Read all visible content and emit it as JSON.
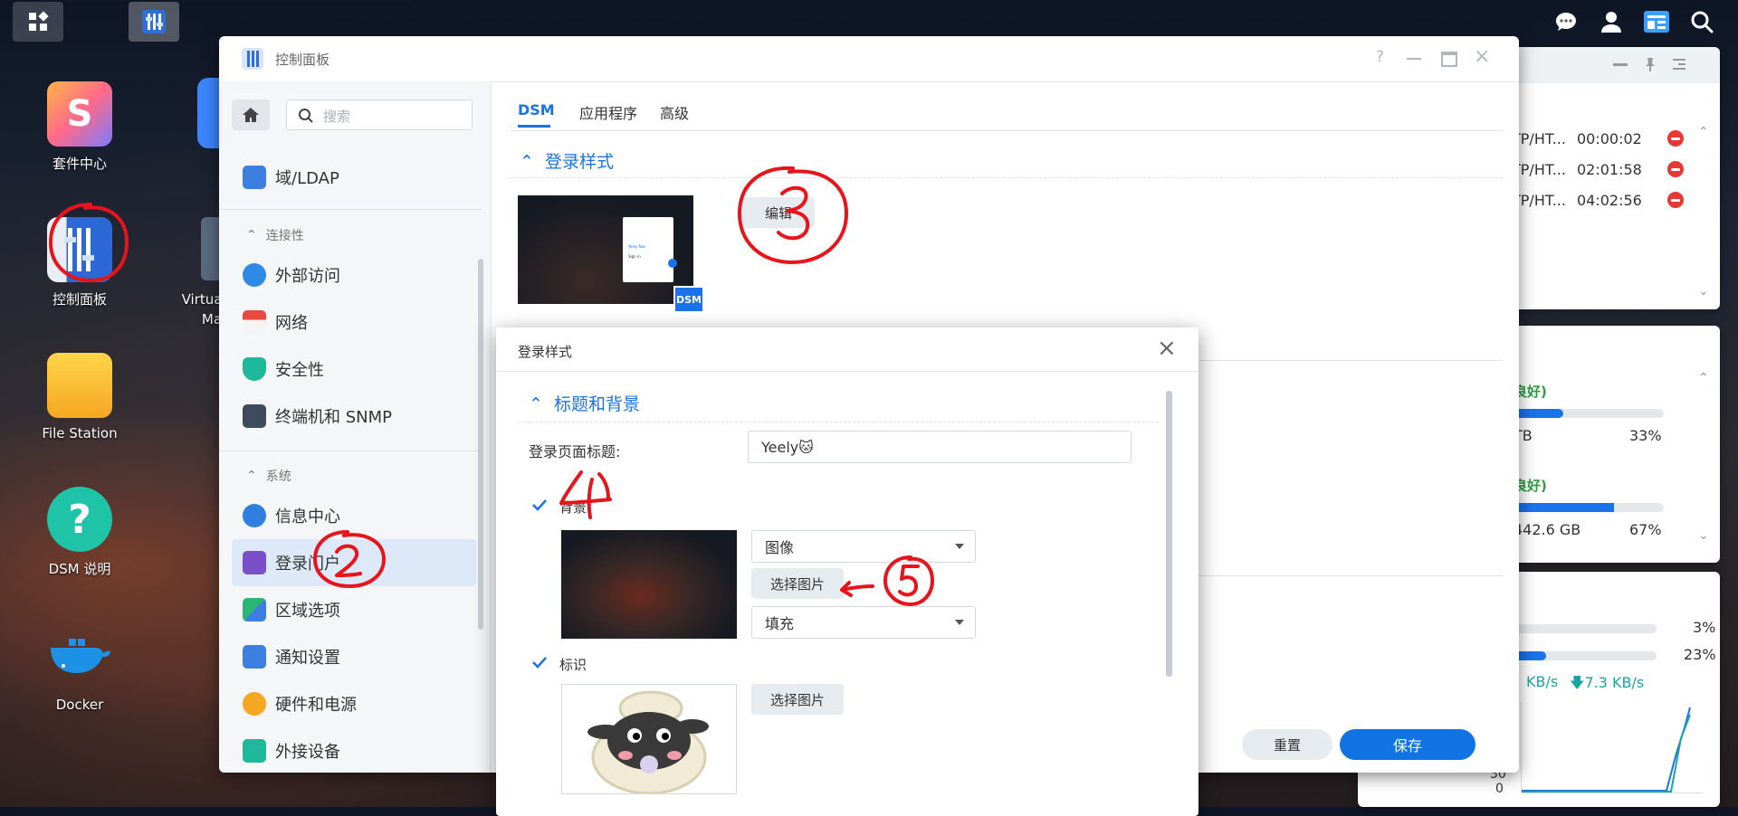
{
  "desktop": {
    "icons": [
      {
        "label": "套件中心"
      },
      {
        "label": "控制面板"
      },
      {
        "label": "File Station"
      },
      {
        "label": "DSM 说明"
      },
      {
        "label": "Docker"
      },
      {
        "label_line1": "Virtua",
        "label_line2": "Ma"
      }
    ]
  },
  "control_panel": {
    "title": "控制面板",
    "search_placeholder": "搜索",
    "sidebar": {
      "items_top": [
        {
          "label": "域/LDAP"
        }
      ],
      "section_connectivity": "连接性",
      "items_connectivity": [
        {
          "label": "外部访问"
        },
        {
          "label": "网络"
        },
        {
          "label": "安全性"
        },
        {
          "label": "终端机和 SNMP"
        }
      ],
      "section_system": "系统",
      "items_system": [
        {
          "label": "信息中心"
        },
        {
          "label": "登录门户"
        },
        {
          "label": "区域选项"
        },
        {
          "label": "通知设置"
        },
        {
          "label": "硬件和电源"
        },
        {
          "label": "外接设备"
        }
      ]
    },
    "tabs": [
      {
        "label": "DSM"
      },
      {
        "label": "应用程序"
      },
      {
        "label": "高级"
      }
    ],
    "active_tab": "DSM",
    "section_title": "登录样式",
    "edit_button": "编辑",
    "dsm_badge": "DSM",
    "preview_card": {
      "line1": "Yeely Nas",
      "line2": "Sign in"
    },
    "footer": {
      "reset": "重置",
      "save": "保存"
    }
  },
  "modal": {
    "title": "登录样式",
    "section_title": "标题和背景",
    "page_title_label": "登录页面标题:",
    "page_title_value": "Yeely🐱",
    "background_checkbox_label": "背景",
    "background_checked": true,
    "background_type_select": "图像",
    "choose_image_button": "选择图片",
    "fill_select": "填充",
    "logo_checkbox_label": "标识",
    "logo_checked": true,
    "logo_choose_image_button": "选择图片"
  },
  "widgets": {
    "connections": [
      {
        "proto": "TP/HT...",
        "time": "00:00:02"
      },
      {
        "proto": "TP/HT...",
        "time": "02:01:58"
      },
      {
        "proto": "TP/HT...",
        "time": "04:02:56"
      }
    ],
    "storage": [
      {
        "status": "良好)",
        "size": "TB",
        "percent": "33%",
        "fill": 0.33
      },
      {
        "status": "良好)",
        "size": "442.6 GB",
        "percent": "67%",
        "fill": 0.67
      }
    ],
    "resource": {
      "cpu_percent": "3%",
      "cpu_fill": 0.03,
      "ram_percent": "23%",
      "ram_fill": 0.23,
      "upload": "KB/s",
      "download": "7.3 KB/s",
      "axis_labels": [
        "30",
        "0"
      ]
    }
  },
  "annotations": [
    "③",
    "④",
    "②",
    "⑤"
  ],
  "colors": {
    "accent": "#1a73e8",
    "save_button": "#1074e5",
    "red_annotation": "#e8141b"
  }
}
